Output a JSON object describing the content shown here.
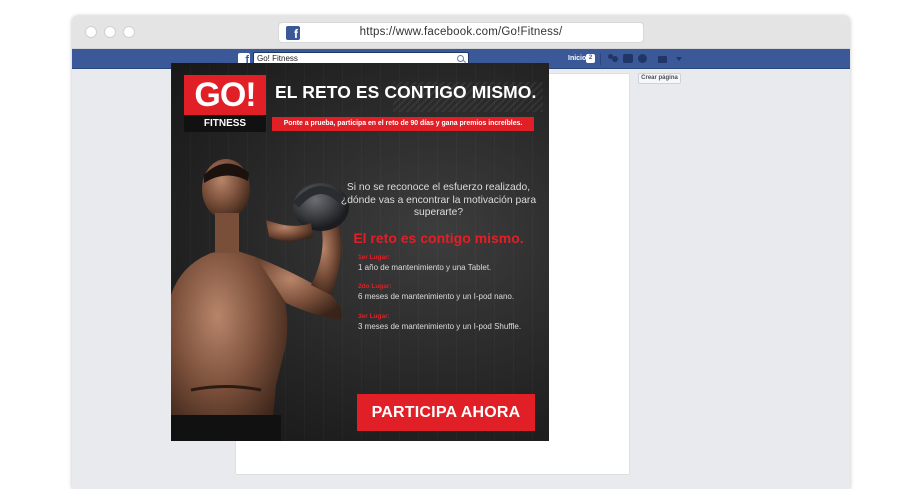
{
  "browser": {
    "url": "https://www.facebook.com/Go!Fitness/"
  },
  "facebook": {
    "search_value": "Go! Fitness",
    "home_label": "Inicio",
    "home_badge": "2",
    "create_page_label": "Crear página"
  },
  "ad": {
    "logo_text": "GO!",
    "logo_subtext": "FITNESS",
    "headline": "EL RETO ES CONTIGO MISMO.",
    "subline": "Ponte a prueba, participa en el reto de 90 días y gana premios increíbles.",
    "question": "Si no se reconoce el esfuerzo realizado, ¿dónde vas a encontrar la motivación para superarte?",
    "slogan": "El reto es contigo mismo.",
    "prizes": [
      {
        "label": "1er Lugar:",
        "text": "1 año de mantenimiento y una Tablet."
      },
      {
        "label": "2do Lugar:",
        "text": "6 meses de mantenimiento y un I-pod nano."
      },
      {
        "label": "3er Lugar:",
        "text": "3 meses de mantenimiento y un I-pod Shuffle."
      }
    ],
    "cta": "PARTICIPA AHORA"
  },
  "colors": {
    "brand_red": "#e11f26",
    "facebook_blue": "#3b5998"
  }
}
